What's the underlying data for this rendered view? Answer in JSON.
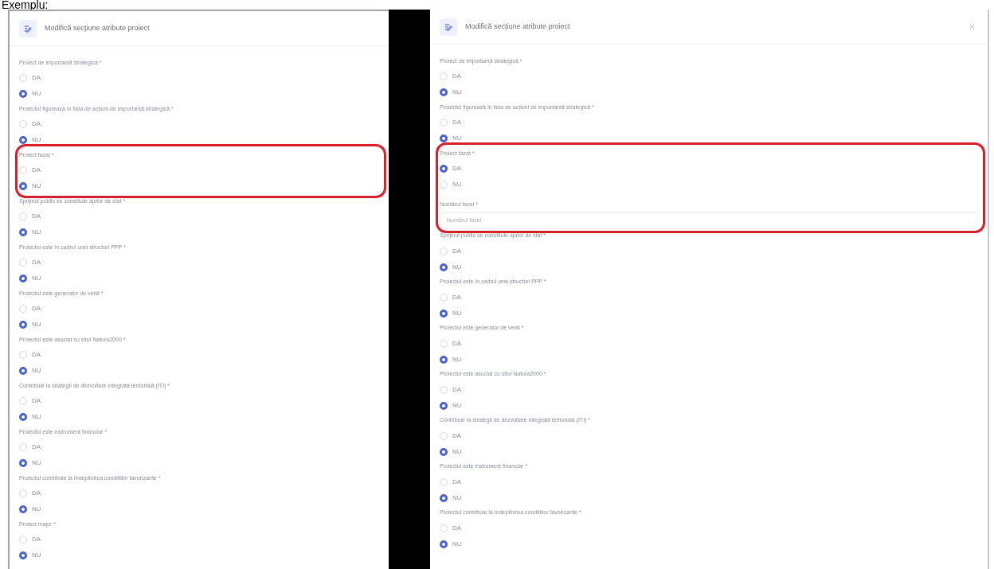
{
  "heading": "Exemplu:",
  "panels": [
    {
      "title": "Modifică secțiune atribute proiect",
      "closable": false,
      "questions": [
        {
          "label": "Proiect de importanță strategică *",
          "highlighted": false,
          "options": [
            {
              "label": "DA",
              "selected": false
            },
            {
              "label": "NU",
              "selected": true
            }
          ]
        },
        {
          "label": "Proiectul figurează în lista de acțiuni de importanță strategică *",
          "highlighted": false,
          "options": [
            {
              "label": "DA",
              "selected": false
            },
            {
              "label": "NU",
              "selected": true
            }
          ]
        },
        {
          "label": "Proiect fazat *",
          "highlighted": true,
          "options": [
            {
              "label": "DA",
              "selected": false
            },
            {
              "label": "NU",
              "selected": true
            }
          ]
        },
        {
          "label": "Sprijinul public se constituie ajutor de stat *",
          "highlighted": false,
          "options": [
            {
              "label": "DA",
              "selected": false
            },
            {
              "label": "NU",
              "selected": true
            }
          ]
        },
        {
          "label": "Proiectul este în cadrul unei structuri PPP *",
          "highlighted": false,
          "options": [
            {
              "label": "DA",
              "selected": false
            },
            {
              "label": "NU",
              "selected": true
            }
          ]
        },
        {
          "label": "Proiectul este generator de venit *",
          "highlighted": false,
          "options": [
            {
              "label": "DA",
              "selected": false
            },
            {
              "label": "NU",
              "selected": true
            }
          ]
        },
        {
          "label": "Proiectul este asociat cu situl Natura2000 *",
          "highlighted": false,
          "options": [
            {
              "label": "DA",
              "selected": false
            },
            {
              "label": "NU",
              "selected": true
            }
          ]
        },
        {
          "label": "Contribuie la strategii de dezvoltare integrată teritorială (ITI) *",
          "highlighted": false,
          "options": [
            {
              "label": "DA",
              "selected": false
            },
            {
              "label": "NU",
              "selected": true
            }
          ]
        },
        {
          "label": "Proiectul este instrument financiar *",
          "highlighted": false,
          "options": [
            {
              "label": "DA",
              "selected": false
            },
            {
              "label": "NU",
              "selected": true
            }
          ]
        },
        {
          "label": "Proiectul contribuie la îndeplinirea condițiilor favorizante *",
          "highlighted": false,
          "options": [
            {
              "label": "DA",
              "selected": false
            },
            {
              "label": "NU",
              "selected": true
            }
          ]
        },
        {
          "label": "Proiect major *",
          "highlighted": false,
          "options": [
            {
              "label": "DA",
              "selected": false
            },
            {
              "label": "NU",
              "selected": true
            }
          ]
        }
      ]
    },
    {
      "title": "Modifică secțiune atribute proiect",
      "closable": true,
      "questions": [
        {
          "label": "Proiect de importanță strategică *",
          "highlighted": false,
          "options": [
            {
              "label": "DA",
              "selected": false
            },
            {
              "label": "NU",
              "selected": true
            }
          ]
        },
        {
          "label": "Proiectul figurează în lista de acțiuni de importanță strategică *",
          "highlighted": false,
          "options": [
            {
              "label": "DA",
              "selected": false
            },
            {
              "label": "NU",
              "selected": true
            }
          ]
        },
        {
          "label": "Proiect fazat *",
          "highlighted": true,
          "options": [
            {
              "label": "DA",
              "selected": true
            },
            {
              "label": "NU",
              "selected": false
            }
          ],
          "field": {
            "label": "Numărul fazei *",
            "placeholder": "Numărul fazei"
          }
        },
        {
          "label": "Sprijinul public se constituie ajutor de stat *",
          "highlighted": false,
          "options": [
            {
              "label": "DA",
              "selected": false
            },
            {
              "label": "NU",
              "selected": true
            }
          ]
        },
        {
          "label": "Proiectul este în cadrul unei structuri PPP *",
          "highlighted": false,
          "options": [
            {
              "label": "DA",
              "selected": false
            },
            {
              "label": "NU",
              "selected": true
            }
          ]
        },
        {
          "label": "Proiectul este generator de venit *",
          "highlighted": false,
          "options": [
            {
              "label": "DA",
              "selected": false
            },
            {
              "label": "NU",
              "selected": true
            }
          ]
        },
        {
          "label": "Proiectul este asociat cu situl Natura2000 *",
          "highlighted": false,
          "options": [
            {
              "label": "DA",
              "selected": false
            },
            {
              "label": "NU",
              "selected": true
            }
          ]
        },
        {
          "label": "Contribuie la strategii de dezvoltare integrată teritorială (ITI) *",
          "highlighted": false,
          "options": [
            {
              "label": "DA",
              "selected": false
            },
            {
              "label": "NU",
              "selected": true
            }
          ]
        },
        {
          "label": "Proiectul este instrument financiar *",
          "highlighted": false,
          "options": [
            {
              "label": "DA",
              "selected": false
            },
            {
              "label": "NU",
              "selected": true
            }
          ]
        },
        {
          "label": "Proiectul contribuie la îndeplinirea condițiilor favorizante *",
          "highlighted": false,
          "options": [
            {
              "label": "DA",
              "selected": false
            },
            {
              "label": "NU",
              "selected": true
            }
          ]
        }
      ]
    }
  ]
}
